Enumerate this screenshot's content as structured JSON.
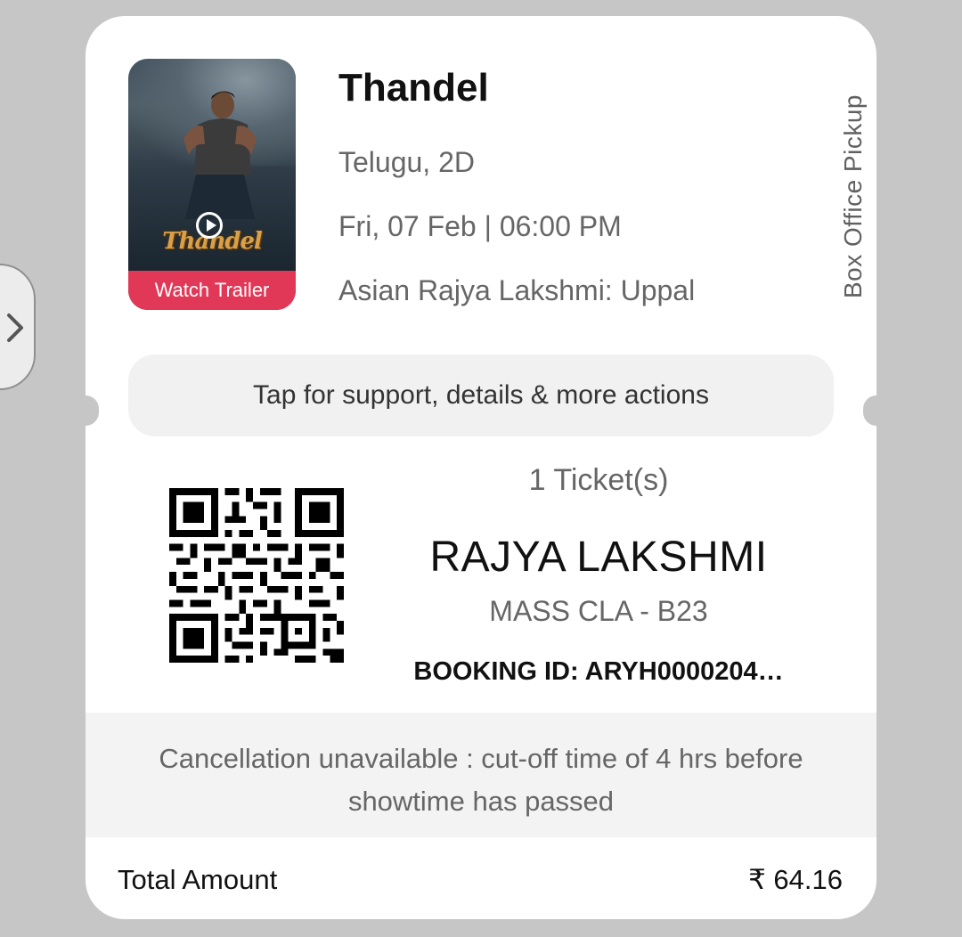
{
  "side_panel": {
    "icon": "chevron-right-icon"
  },
  "movie": {
    "title": "Thandel",
    "language_format": "Telugu, 2D",
    "datetime": "Fri, 07 Feb | 06:00 PM",
    "venue": "Asian Rajya Lakshmi: Uppal",
    "poster_logo": "Thandel",
    "trailer_label": "Watch Trailer",
    "pickup_label": "Box Office Pickup"
  },
  "support": {
    "label": "Tap for support, details & more actions"
  },
  "ticket": {
    "count": "1 Ticket(s)",
    "screen": "RAJYA LAKSHMI",
    "seat": "MASS CLA - B23",
    "booking_id": "BOOKING ID: ARYH0000204…"
  },
  "cancellation": {
    "message": "Cancellation unavailable : cut-off time of 4 hrs before showtime has passed"
  },
  "total": {
    "label": "Total Amount",
    "value": "₹ 64.16"
  },
  "colors": {
    "accent": "#e23857",
    "background": "#c6c6c6",
    "card": "#ffffff"
  }
}
